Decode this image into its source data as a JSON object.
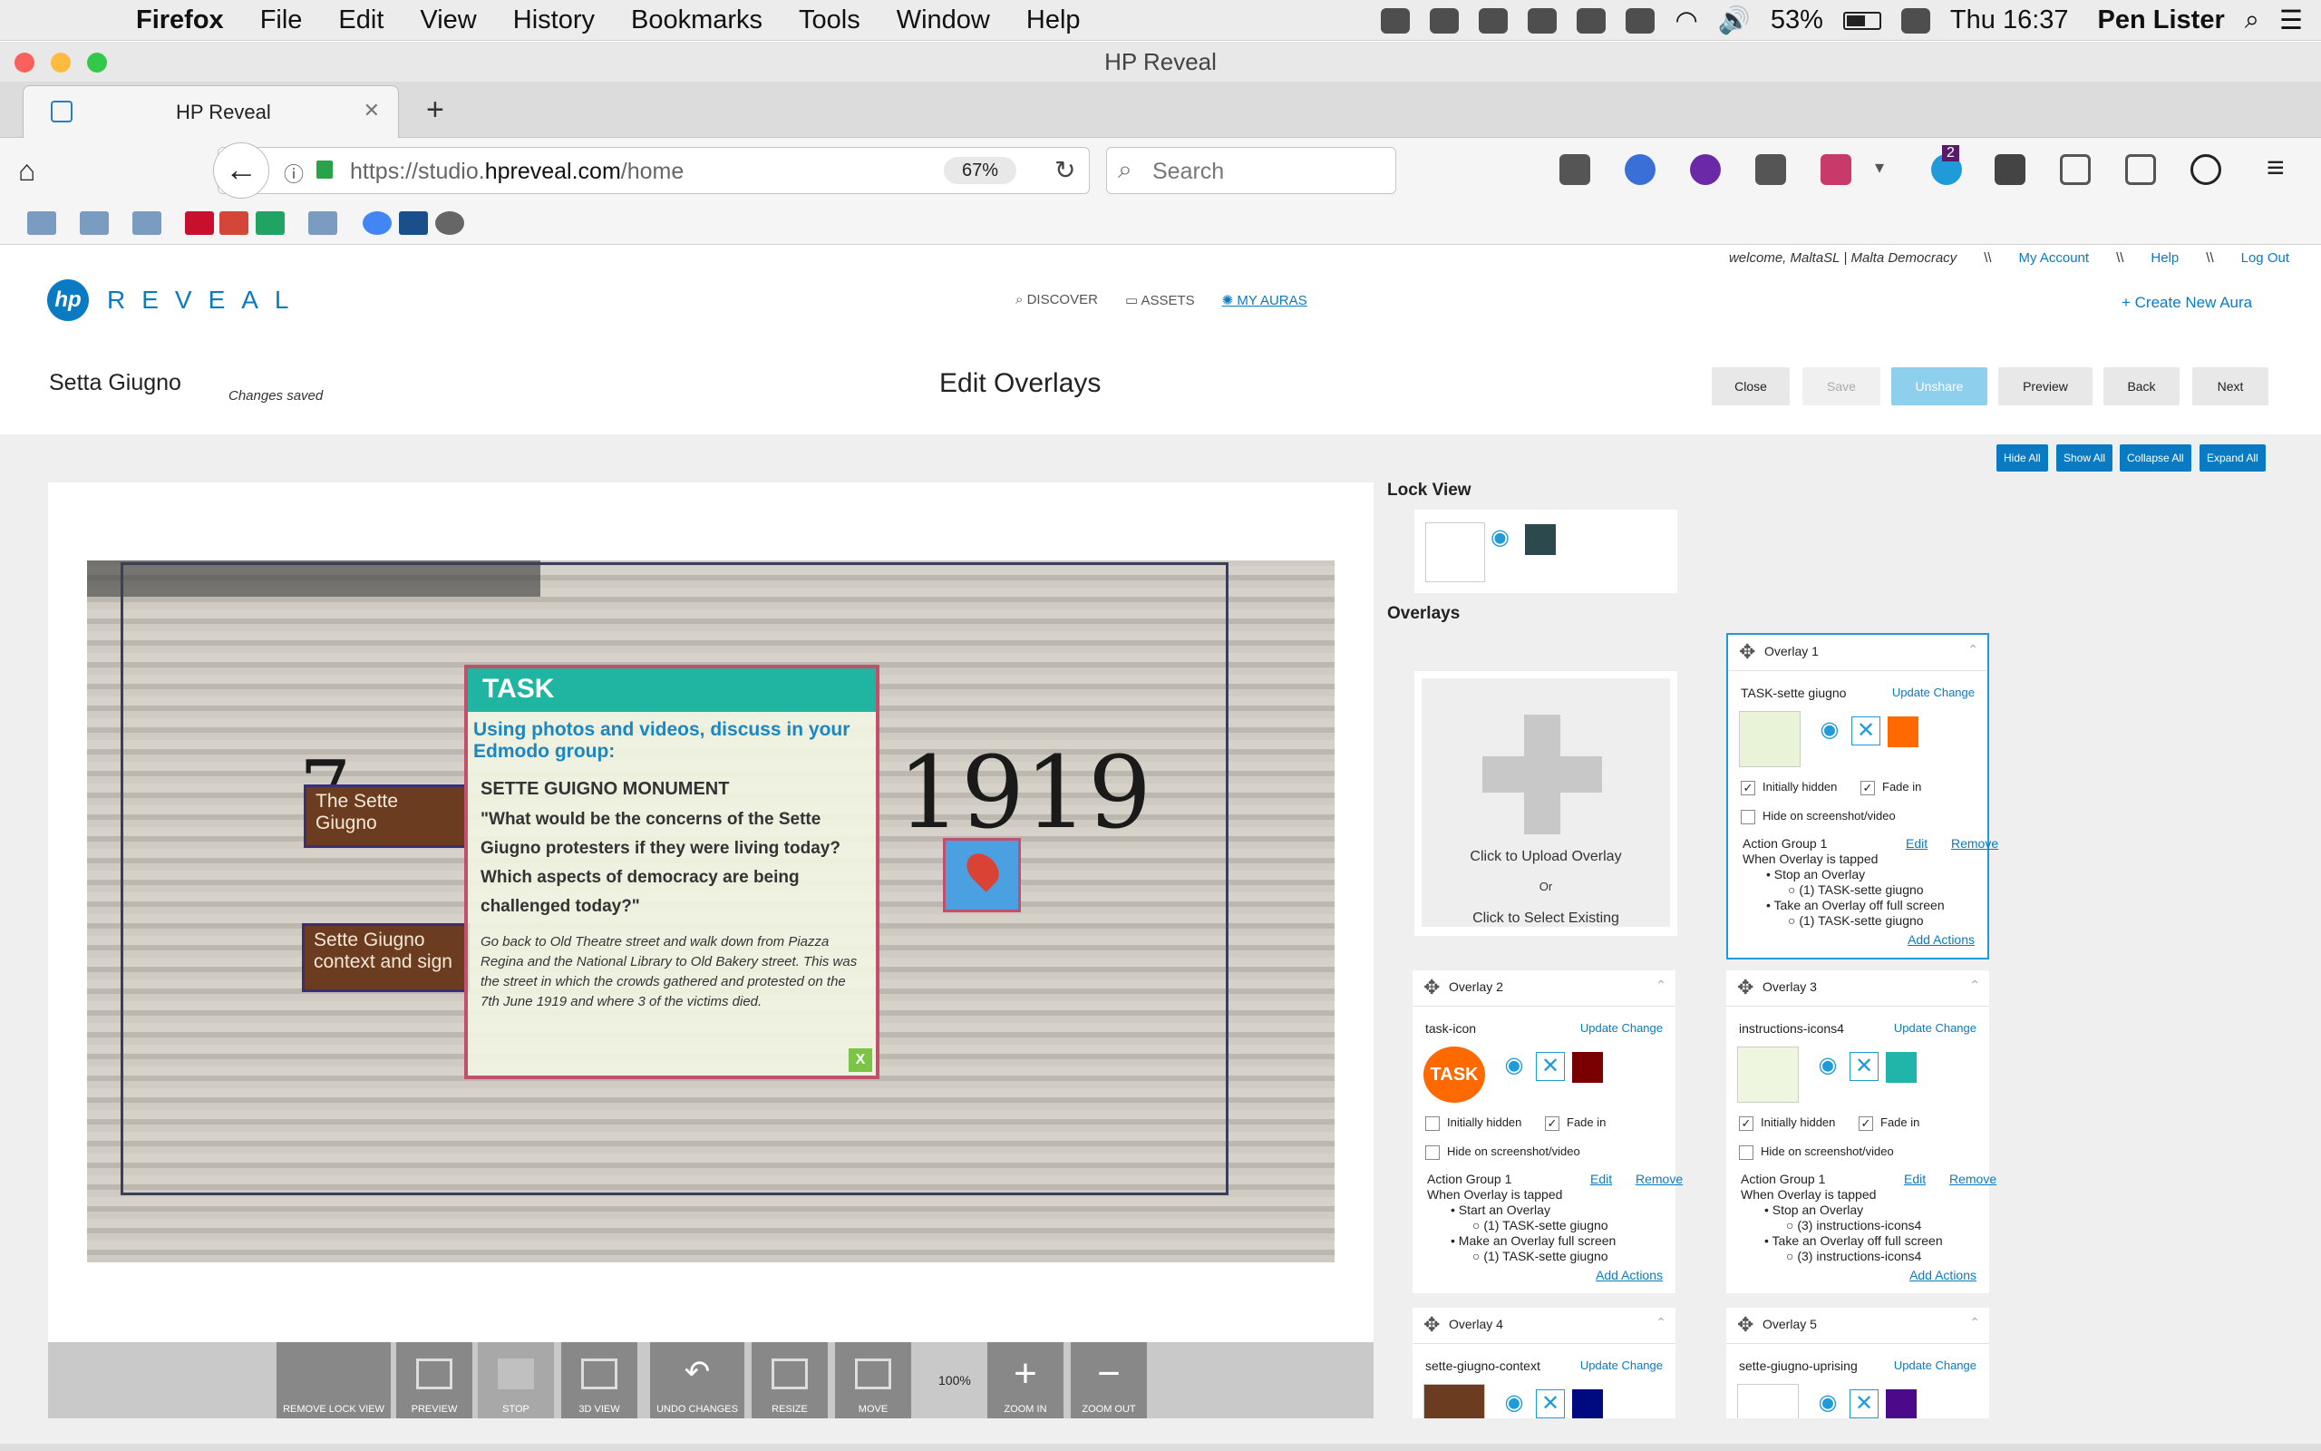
{
  "menubar": {
    "app": "Firefox",
    "items": [
      "File",
      "Edit",
      "View",
      "History",
      "Bookmarks",
      "Tools",
      "Window",
      "Help"
    ],
    "battery": "53%",
    "clock": "Thu 16:37",
    "user": "Pen Lister"
  },
  "window": {
    "title": "HP Reveal"
  },
  "tab": {
    "title": "HP Reveal"
  },
  "navbar": {
    "url_prefix": "https://studio.",
    "url_domain": "hpreveal.com",
    "url_path": "/home",
    "zoom": "67%",
    "search_placeholder": "Search",
    "notification_badge": "2"
  },
  "site": {
    "welcome": "welcome, MaltaSL | Malta Democracy",
    "sep": "\\\\",
    "my_account": "My Account",
    "help": "Help",
    "logout": "Log Out",
    "logo_hp": "hp",
    "logo_text": "REVEAL",
    "nav": [
      "DISCOVER",
      "ASSETS",
      "MY AURAS"
    ],
    "create_aura": "Create New Aura"
  },
  "editor": {
    "project_name": "Setta Giugno",
    "status": "Changes saved",
    "title": "Edit Overlays",
    "buttons": [
      "Close",
      "Save",
      "Unshare",
      "Preview",
      "Back",
      "Next"
    ],
    "panel_buttons": [
      "Hide All",
      "Show All",
      "Collapse All",
      "Expand All"
    ]
  },
  "canvas": {
    "year": "1919",
    "label1": "The Sette Giugno",
    "label2": "Sette Giugno context and sign",
    "task": {
      "header": "TASK",
      "lead": "Using photos and videos, discuss in your Edmodo group:",
      "monument": "SETTE GUIGNO MONUMENT",
      "question": "\"What would be the concerns of the Sette Giugno protesters if they were living today? Which aspects of democracy are being challenged today?\"",
      "instructions": "Go back to Old Theatre street and walk down from Piazza Regina and the National Library to Old Bakery street. This was the street in which the crowds gathered and protested on the 7th June 1919 and where 3 of the victims died.",
      "close": "X"
    }
  },
  "tools": [
    {
      "label": "REMOVE LOCK VIEW"
    },
    {
      "label": "PREVIEW"
    },
    {
      "label": "STOP"
    },
    {
      "label": "3D VIEW"
    },
    {
      "label": "UNDO CHANGES"
    },
    {
      "label": "RESIZE"
    },
    {
      "label": "MOVE"
    },
    {
      "label": "100%"
    },
    {
      "label": "ZOOM IN"
    },
    {
      "label": "ZOOM OUT"
    }
  ],
  "panel": {
    "lock_view": "Lock View",
    "overlays": "Overlays",
    "upload": "Click to Upload Overlay",
    "or": "Or",
    "select": "Click to Select Existing",
    "update": "Update",
    "change": "Change",
    "initially_hidden": "Initially hidden",
    "fade_in": "Fade in",
    "hide_on_screenshot": "Hide on screenshot/video",
    "action_group": "Action Group 1",
    "edit": "Edit",
    "remove": "Remove",
    "when_tapped": "When Overlay is tapped",
    "add_actions": "Add Actions",
    "lock_swatch": "#2c4a4e",
    "cards": [
      {
        "title": "Overlay 1",
        "file": "TASK-sette giugno",
        "swatch": "#ff6a00",
        "hidden": true,
        "fade": true,
        "a1": "Stop an Overlay",
        "a1s": "(1) TASK-sette giugno",
        "a2": "Take an Overlay off full screen",
        "a2s": "(1) TASK-sette giugno"
      },
      {
        "title": "Overlay 2",
        "file": "task-icon",
        "swatch": "#7a0000",
        "hidden": false,
        "fade": true,
        "a1": "Start an Overlay",
        "a1s": "(1) TASK-sette giugno",
        "a2": "Make an Overlay full screen",
        "a2s": "(1) TASK-sette giugno"
      },
      {
        "title": "Overlay 3",
        "file": "instructions-icons4",
        "swatch": "#1fb5a8",
        "hidden": true,
        "fade": true,
        "a1": "Stop an Overlay",
        "a1s": "(3) instructions-icons4",
        "a2": "Take an Overlay off full screen",
        "a2s": "(3) instructions-icons4"
      },
      {
        "title": "Overlay 4",
        "file": "sette-giugno-context",
        "swatch": "#000a80"
      },
      {
        "title": "Overlay 5",
        "file": "sette-giugno-uprising",
        "swatch": "#4b0a8a"
      }
    ]
  }
}
